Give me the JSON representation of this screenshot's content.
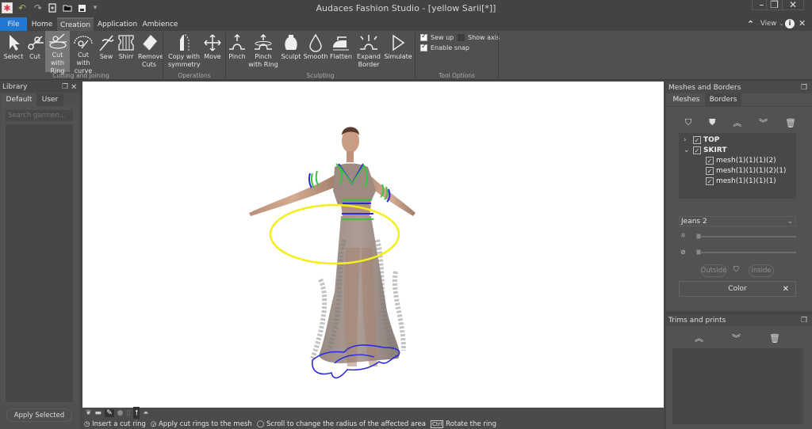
{
  "window": {
    "title": "Audaces Fashion Studio - [yellow Sarii[*]]",
    "controls": {
      "minimize": "–",
      "restore": "❐",
      "close": "✕"
    }
  },
  "quick_access": [
    {
      "name": "undo-icon",
      "glyph": "↶"
    },
    {
      "name": "redo-icon",
      "glyph": "↷"
    },
    {
      "name": "new-file-icon",
      "glyph": "🗋"
    },
    {
      "name": "open-folder-icon",
      "glyph": "▭"
    },
    {
      "name": "save-icon",
      "glyph": "▪"
    },
    {
      "name": "customize-dropdown-icon",
      "glyph": "▾"
    }
  ],
  "ribbon_tabs": [
    {
      "label": "File",
      "active": false,
      "accent": true
    },
    {
      "label": "Home",
      "active": false
    },
    {
      "label": "Creation",
      "active": true
    },
    {
      "label": "Application",
      "active": false
    },
    {
      "label": "Ambience",
      "active": false
    }
  ],
  "ribbon_right": {
    "view_label": "View",
    "collapse_glyph": "⌃",
    "info_glyph": "i",
    "close_glyph": "✕"
  },
  "ribbon_groups": [
    {
      "label": "Cutting and Joining",
      "tools": [
        {
          "label": "Select",
          "icon": "cursor-icon"
        },
        {
          "label": "Cut",
          "icon": "scissors-icon"
        },
        {
          "label": "Cut with Ring",
          "icon": "scissors-ring-icon",
          "active": true
        },
        {
          "label": "Cut with curve",
          "icon": "scissors-curve-icon"
        },
        {
          "label": "Sew",
          "icon": "needle-icon"
        },
        {
          "label": "Shirr",
          "icon": "shirr-icon"
        },
        {
          "label": "Remove Cuts",
          "icon": "eraser-icon"
        }
      ]
    },
    {
      "label": "Operations",
      "tools": [
        {
          "label": "Copy with symmetry",
          "icon": "symmetry-icon"
        },
        {
          "label": "Move",
          "icon": "move-arrows-icon"
        }
      ]
    },
    {
      "label": "Sculpting",
      "tools": [
        {
          "label": "Pinch",
          "icon": "pinch-icon"
        },
        {
          "label": "Pinch with Ring",
          "icon": "pinch-ring-icon"
        },
        {
          "label": "Sculpt",
          "icon": "vase-icon"
        },
        {
          "label": "Smooth",
          "icon": "drop-icon"
        },
        {
          "label": "Flatten",
          "icon": "iron-icon"
        },
        {
          "label": "Expand Border",
          "icon": "expand-border-icon"
        },
        {
          "label": "Simulate",
          "icon": "play-icon"
        }
      ]
    },
    {
      "label": "Tool Options",
      "options": [
        {
          "label": "Sew up",
          "checked": true
        },
        {
          "label": "Show axis",
          "checked": false
        },
        {
          "label": "Enable snap",
          "checked": true
        }
      ]
    }
  ],
  "library": {
    "title": "Library",
    "tabs": [
      "Default",
      "User"
    ],
    "active_tab": "Default",
    "search_placeholder": "Search garmen...",
    "apply_button": "Apply Selected"
  },
  "viewport": {
    "ring_color": "#f5ee19",
    "seam_blue": "#2b2bd9",
    "seam_green": "#3ec23e"
  },
  "viewport_toolbar": [
    "camera-bird-icon",
    "video-camera-icon",
    "pencil-icon",
    "sphere-icon",
    "capsule-icon",
    "arrow-up-icon",
    "person-arrow-icon"
  ],
  "status_hints": [
    {
      "icon": "mouse-left-icon",
      "text": "Insert a cut ring"
    },
    {
      "icon": "mouse-right-icon",
      "text": "Apply cut rings to the mesh"
    },
    {
      "icon": "mouse-scroll-icon",
      "text": "Scroll to change the radius of the affected area"
    },
    {
      "icon": "ctrl-key-icon",
      "key": "Ctrl",
      "text": "Rotate the ring"
    }
  ],
  "meshes_panel": {
    "title": "Meshes and Borders",
    "tabs": [
      "Meshes",
      "Borders"
    ],
    "active_tab": "Meshes",
    "toolbar": [
      "add-garment-icon",
      "paint-garment-icon",
      "move-up-icon",
      "move-down-icon",
      "trash-icon"
    ],
    "tree": [
      {
        "label": "TOP",
        "expanded": false,
        "checked": true,
        "children": []
      },
      {
        "label": "SKIRT",
        "expanded": true,
        "checked": true,
        "children": [
          {
            "label": "mesh(1)(1)(1)(2)",
            "checked": true
          },
          {
            "label": "mesh(1)(1)(1)(2)(1)",
            "checked": true
          },
          {
            "label": "mesh(1)(1)(1)(1)",
            "checked": true
          }
        ]
      }
    ],
    "material_select": "Jeans 2",
    "sliders": [
      {
        "icon": "brightness-icon",
        "value": 0
      },
      {
        "icon": "hide-eye-icon",
        "value": 0
      }
    ],
    "outside_label": "Outside",
    "inside_label": "Inside",
    "color_label": "Color",
    "color_clear_glyph": "✕"
  },
  "trims_panel": {
    "title": "Trims and prints",
    "toolbar": [
      "move-up-icon",
      "move-down-icon",
      "trash-icon"
    ]
  }
}
